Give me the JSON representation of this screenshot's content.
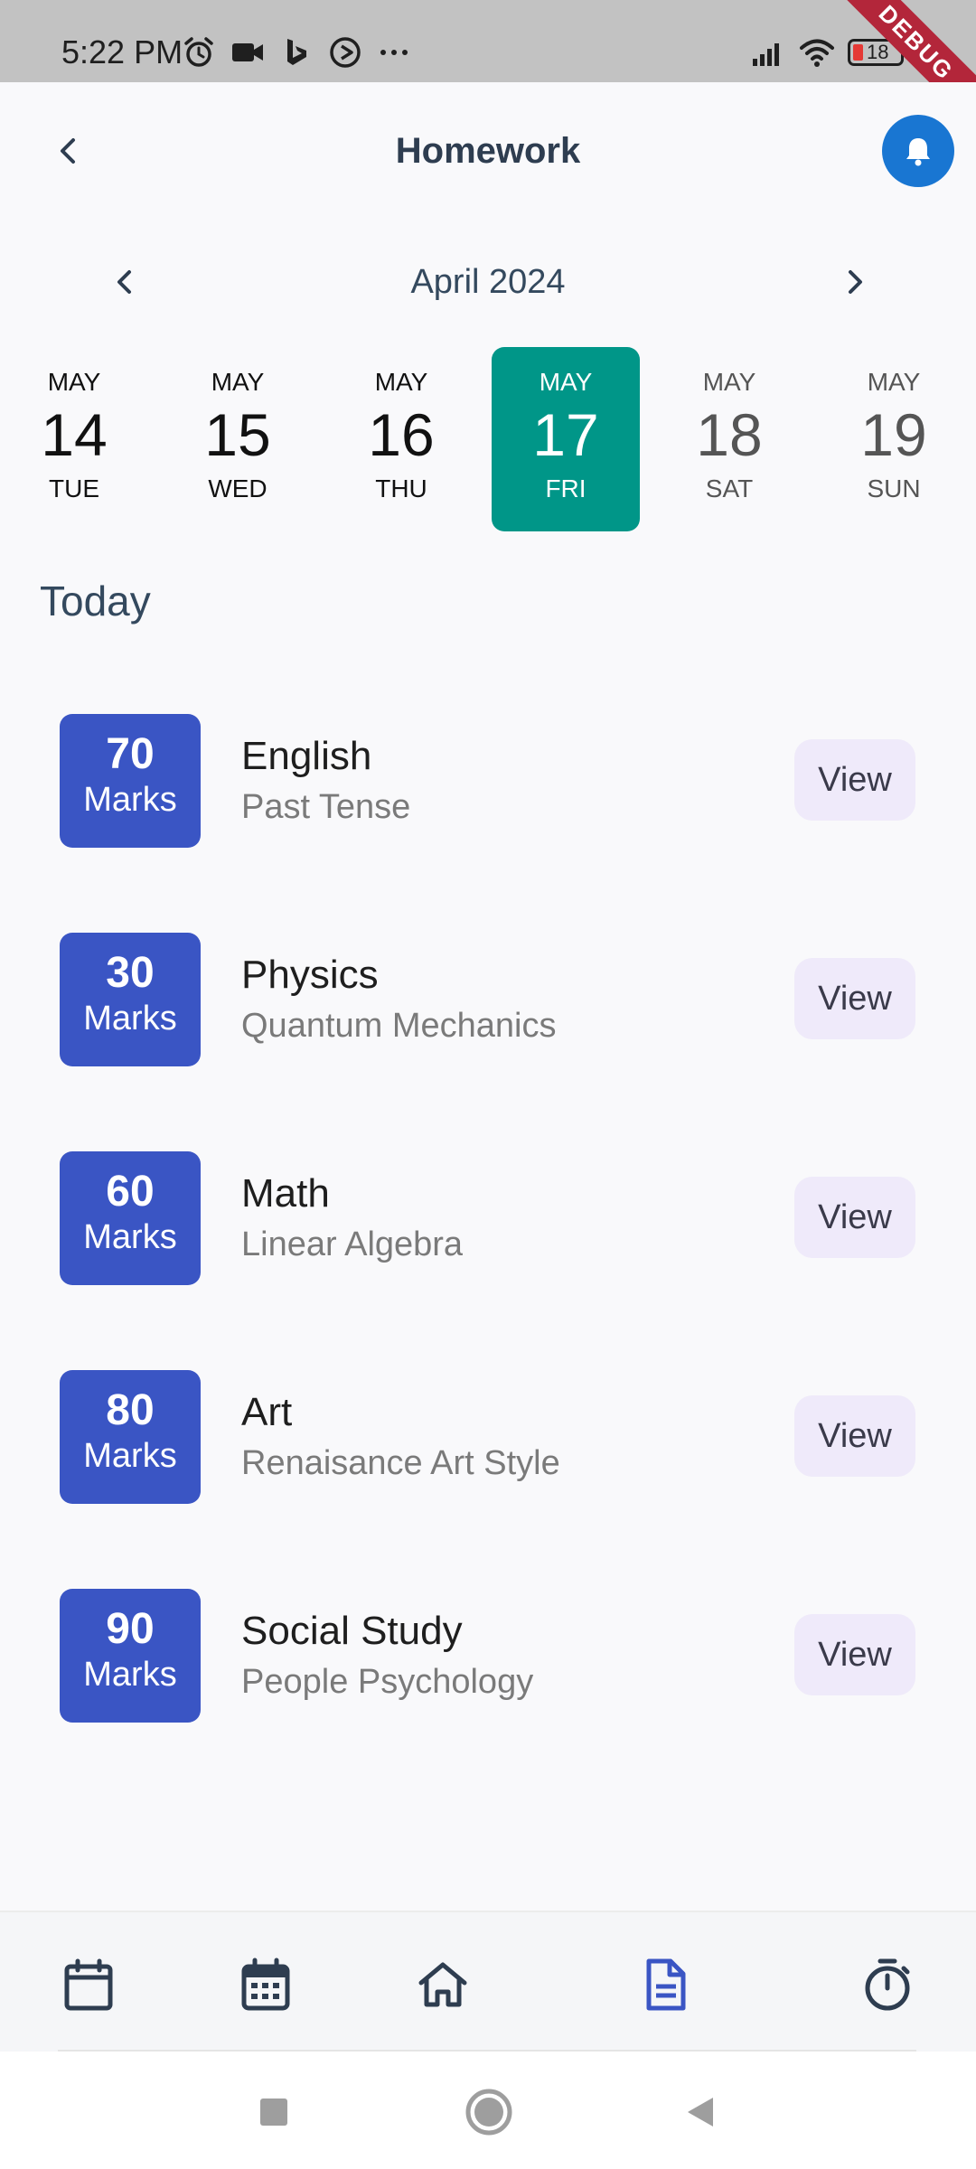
{
  "status_bar": {
    "time": "5:22 PM",
    "battery_level": "18",
    "left_icons": [
      "alarm-icon",
      "video-camera-icon",
      "bing-icon",
      "play-circle-icon",
      "more-dots-icon"
    ],
    "right_icons": [
      "signal-icon",
      "wifi-icon",
      "battery-icon"
    ],
    "debug_banner": "DEBUG"
  },
  "app_bar": {
    "title": "Homework",
    "back_icon": "chevron-left-icon",
    "notification_icon": "bell-icon",
    "accent": "#1976D2"
  },
  "calendar": {
    "month_label": "April 2024",
    "days": [
      {
        "month": "MAY",
        "day": "14",
        "weekday": "TUE",
        "state": "past"
      },
      {
        "month": "MAY",
        "day": "15",
        "weekday": "WED",
        "state": "past"
      },
      {
        "month": "MAY",
        "day": "16",
        "weekday": "THU",
        "state": "past"
      },
      {
        "month": "MAY",
        "day": "17",
        "weekday": "FRI",
        "state": "selected"
      },
      {
        "month": "MAY",
        "day": "18",
        "weekday": "SAT",
        "state": "future"
      },
      {
        "month": "MAY",
        "day": "19",
        "weekday": "SUN",
        "state": "future"
      }
    ],
    "selected_color": "#009688"
  },
  "section": {
    "title": "Today"
  },
  "homework": {
    "marks_color": "#3A55C4",
    "view_bg": "#EFEAFA",
    "items": [
      {
        "marks": "70",
        "marks_label": "Marks",
        "subject": "English",
        "topic": "Past Tense",
        "action": "View"
      },
      {
        "marks": "30",
        "marks_label": "Marks",
        "subject": "Physics",
        "topic": "Quantum Mechanics",
        "action": "View"
      },
      {
        "marks": "60",
        "marks_label": "Marks",
        "subject": "Math",
        "topic": "Linear Algebra",
        "action": "View"
      },
      {
        "marks": "80",
        "marks_label": "Marks",
        "subject": "Art",
        "topic": "Renaisance Art Style",
        "action": "View"
      },
      {
        "marks": "90",
        "marks_label": "Marks",
        "subject": "Social Study",
        "topic": "People Psychology",
        "action": "View"
      }
    ]
  },
  "bottom_nav": {
    "items": [
      {
        "icon": "calendar-blank-icon",
        "active": false
      },
      {
        "icon": "calendar-grid-icon",
        "active": false
      },
      {
        "icon": "home-icon",
        "active": false
      },
      {
        "icon": "document-icon",
        "active": true
      },
      {
        "icon": "timer-icon",
        "active": false
      }
    ],
    "active_color": "#3A55C4",
    "inactive_color": "#2E3D50"
  },
  "system_nav": {
    "buttons": [
      "recents-square-icon",
      "home-circle-icon",
      "back-triangle-icon"
    ]
  }
}
